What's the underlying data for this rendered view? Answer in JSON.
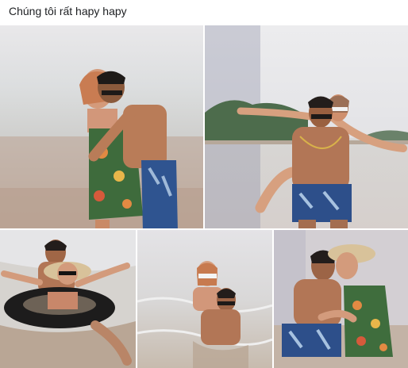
{
  "post": {
    "caption": "Chúng tôi rất hapy hapy"
  },
  "photos": [
    {
      "name": "photo-1",
      "subject": "couple-hugging-on-beach"
    },
    {
      "name": "photo-2",
      "subject": "piggyback-on-beach"
    },
    {
      "name": "photo-3",
      "subject": "couple-in-swim-ring"
    },
    {
      "name": "photo-4",
      "subject": "couple-sitting-in-water"
    },
    {
      "name": "photo-5",
      "subject": "couple-kissing-on-beach"
    }
  ],
  "colors": {
    "caption_text": "#1c1e21",
    "background": "#ffffff",
    "sand": "#cbb8a8",
    "water": "#dfe2e4",
    "skin": "#c98a66",
    "blue_shorts": "#2f5490",
    "floral_swimsuit": "#3f6d3d"
  }
}
